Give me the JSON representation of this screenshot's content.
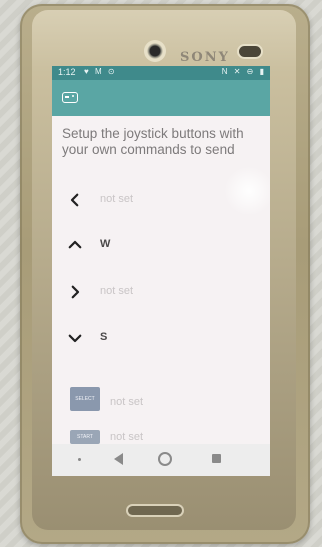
{
  "device": {
    "brand": "SONY"
  },
  "statusbar": {
    "time": "1:12",
    "left_icons": "♥ M ⊙",
    "right_icons": "N ✕ ⊖ ▮"
  },
  "appbar": {
    "icon": "gamepad-icon"
  },
  "intro_text": "Setup the joystick buttons with your own commands to send",
  "joystick": {
    "left": {
      "icon": "chevron-left-icon",
      "value": "not set"
    },
    "up": {
      "icon": "chevron-up-icon",
      "value": "W"
    },
    "right": {
      "icon": "chevron-right-icon",
      "value": "not set"
    },
    "down": {
      "icon": "chevron-down-icon",
      "value": "S"
    },
    "select": {
      "label": "SELECT",
      "value": "not set"
    },
    "start": {
      "label": "START",
      "value": "not set"
    }
  },
  "navbar": {
    "dot": "nav-dot",
    "back": "back-icon",
    "home": "home-icon",
    "recent": "recent-apps-icon"
  },
  "colors": {
    "status_bar": "#3f8a8b",
    "app_bar": "#5aa6a4",
    "select_button": "#8a98ad",
    "not_set_text": "#c9c5c6"
  }
}
